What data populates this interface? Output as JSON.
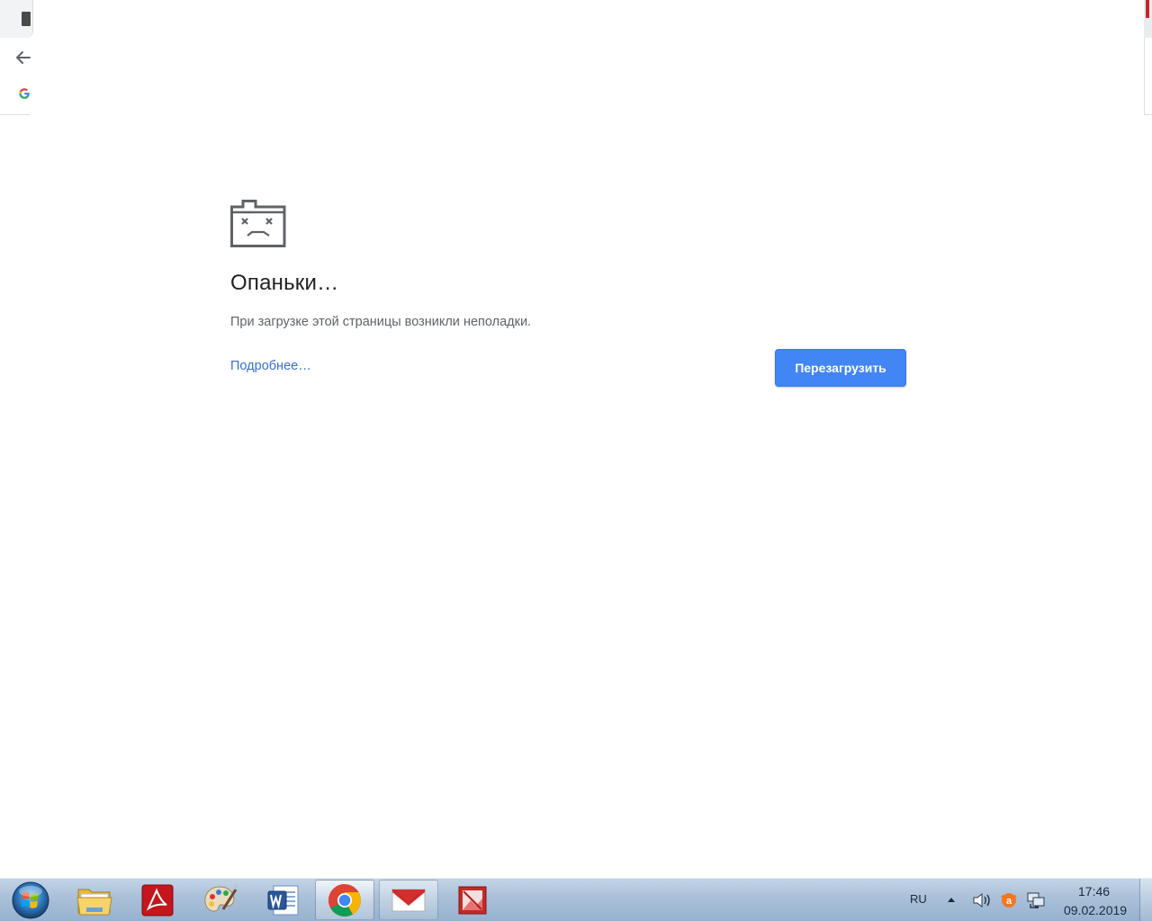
{
  "error_page": {
    "title": "Опаньки…",
    "message": "При загрузке этой страницы возникли неполадки.",
    "details_link": "Подробнее…",
    "reload_button": "Перезагрузить"
  },
  "taskbar": {
    "pinned": [
      {
        "name": "windows-explorer",
        "icon": "folder-icon"
      },
      {
        "name": "adobe-reader",
        "icon": "adobe-acrobat-icon"
      },
      {
        "name": "paint",
        "icon": "paint-palette-icon"
      },
      {
        "name": "microsoft-word",
        "icon": "word-icon"
      },
      {
        "name": "google-chrome",
        "icon": "chrome-icon",
        "state": "active"
      },
      {
        "name": "mail",
        "icon": "mail-envelope-icon",
        "state": "open"
      },
      {
        "name": "picture-viewer",
        "icon": "image-viewer-icon"
      }
    ],
    "tray": {
      "language": "RU",
      "time": "17:46",
      "date": "09.02.2019"
    }
  },
  "colors": {
    "reload_button": "#4285f4",
    "link": "#3a6ed1",
    "title": "#202124",
    "message": "#5f6368"
  }
}
